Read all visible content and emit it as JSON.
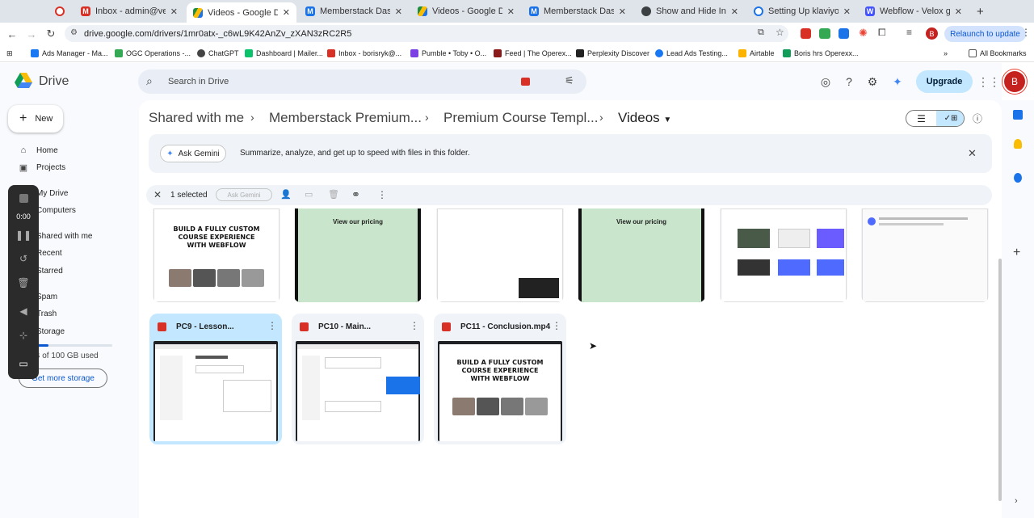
{
  "tabs": [
    {
      "title": "Inbox - admin@veloxgro",
      "icon": "gmail-icon",
      "color": "#d93025"
    },
    {
      "title": "Videos - Google Drive",
      "icon": "drive-icon",
      "color": "#1e8e3e",
      "active": true
    },
    {
      "title": "Memberstack Dashboar",
      "icon": "memberstack-icon",
      "color": "#1a73e8"
    },
    {
      "title": "Videos - Google Drive",
      "icon": "drive-icon",
      "color": "#1e8e3e"
    },
    {
      "title": "Memberstack Dashboar",
      "icon": "memberstack-icon",
      "color": "#1a73e8"
    },
    {
      "title": "Show and Hide Individu",
      "icon": "globe-icon",
      "color": "#3c4043"
    },
    {
      "title": "Setting Up klaviyo vid",
      "icon": "clock-icon",
      "color": "#1a73e8"
    },
    {
      "title": "Webflow - Velox growth",
      "icon": "webflow-icon",
      "color": "#4353ff"
    }
  ],
  "url": "drive.google.com/drivers/1mr0atx-_c6wL9K42AnZv_zXAN3zRC2R5",
  "relaunch": "Relaunch to update",
  "bookmarks": [
    "Ads Manager - Ma...",
    "OGC Operations -...",
    "ChatGPT",
    "Dashboard | Mailer...",
    "Inbox - borisryk@...",
    "Pumble • Toby • O...",
    "Feed | The Operex...",
    "Perplexity Discover",
    "Lead Ads Testing...",
    "Airtable",
    "Boris hrs Operexx..."
  ],
  "all_bookmarks": "All Bookmarks",
  "drive_title": "Drive",
  "search_placeholder": "Search in Drive",
  "upgrade": "Upgrade",
  "avatar": "B",
  "new_label": "New",
  "nav": {
    "home": "Home",
    "projects": "Projects",
    "mydrive": "My Drive",
    "computers": "Computers",
    "shared": "Shared with me",
    "recent": "Recent",
    "starred": "Starred",
    "spam": "Spam",
    "trash": "Trash",
    "storage": "Storage"
  },
  "storage_used": "GB of 100 GB used",
  "get_storage": "Get more storage",
  "rec_time": "0:00",
  "breadcrumb": [
    "Shared with me",
    "Memberstack Premium...",
    "Premium Course Templ...",
    "Videos"
  ],
  "gemini": {
    "button": "Ask Gemini",
    "text": "Summarize, analyze, and get up to speed with files in this folder."
  },
  "selection": {
    "count": "1 selected",
    "ask": "Ask Gemini"
  },
  "top_thumbs": {
    "build1": "BUILD A FULLY CUSTOM",
    "build2": "COURSE EXPERIENCE",
    "build3": "WITH WEBFLOW",
    "pricing": "View our pricing"
  },
  "files": [
    {
      "name": "PC9 - Lesson...",
      "selected": true
    },
    {
      "name": "PC10 - Main..."
    },
    {
      "name": "PC11 - Conclusion.mp4"
    }
  ]
}
